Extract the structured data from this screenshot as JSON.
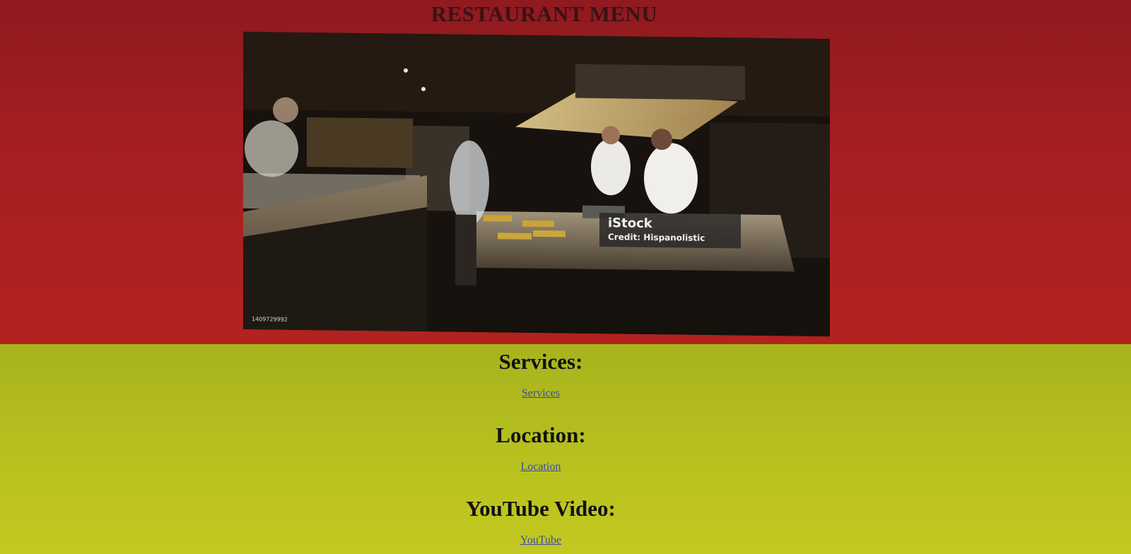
{
  "page": {
    "title": "RESTAURANT MENU"
  },
  "hero_image": {
    "alt": "",
    "watermark_brand": "iStock",
    "watermark_credit": "Credit: Hispanolistic",
    "image_id": "1409729992"
  },
  "sections": {
    "services": {
      "heading": "Services:",
      "link": "Services"
    },
    "location": {
      "heading": "Location:",
      "link": "Location"
    },
    "youtube": {
      "heading": "YouTube Video:",
      "link": "YouTube"
    }
  },
  "colors": {
    "header_bg": "#a61f22",
    "content_bg": "#b9c21f",
    "link": "#3a4aa8",
    "heading": "#111111",
    "title": "#3a1215"
  }
}
